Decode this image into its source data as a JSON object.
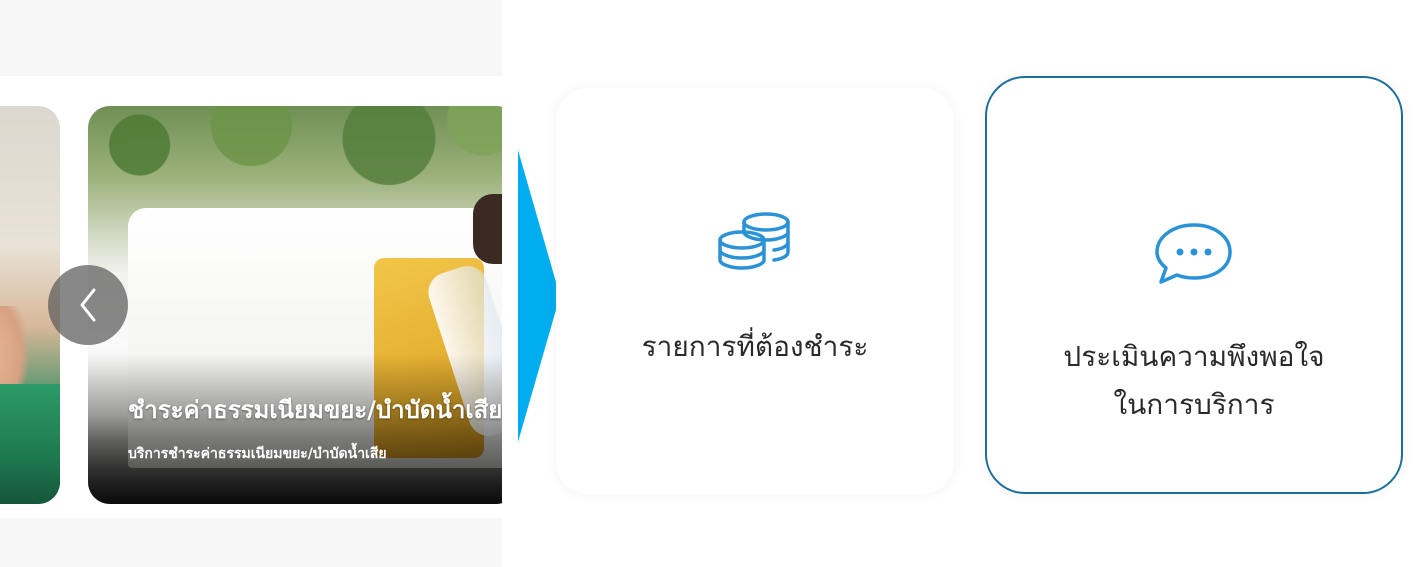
{
  "carousel": {
    "current": {
      "title": "ชำระค่าธรรมเนียมขยะ/บำบัดน้ำเสีย",
      "subtitle": "บริการชำระค่าธรรมเนียมขยะ/บำบัดน้ำเสีย"
    },
    "prev_button_icon": "chevron-left-icon"
  },
  "arrow": {
    "icon": "arrow-right-icon",
    "color": "#00aeef"
  },
  "services": [
    {
      "label": "รายการที่ต้องชำระ",
      "icon": "coins-stack-icon"
    },
    {
      "label_line1": "ประเมินความพึงพอใจ",
      "label_line2": "ในการบริการ",
      "icon": "chat-bubble-icon"
    }
  ],
  "colors": {
    "icon": "#2a92d6",
    "selected_border": "#1c6e9a"
  }
}
